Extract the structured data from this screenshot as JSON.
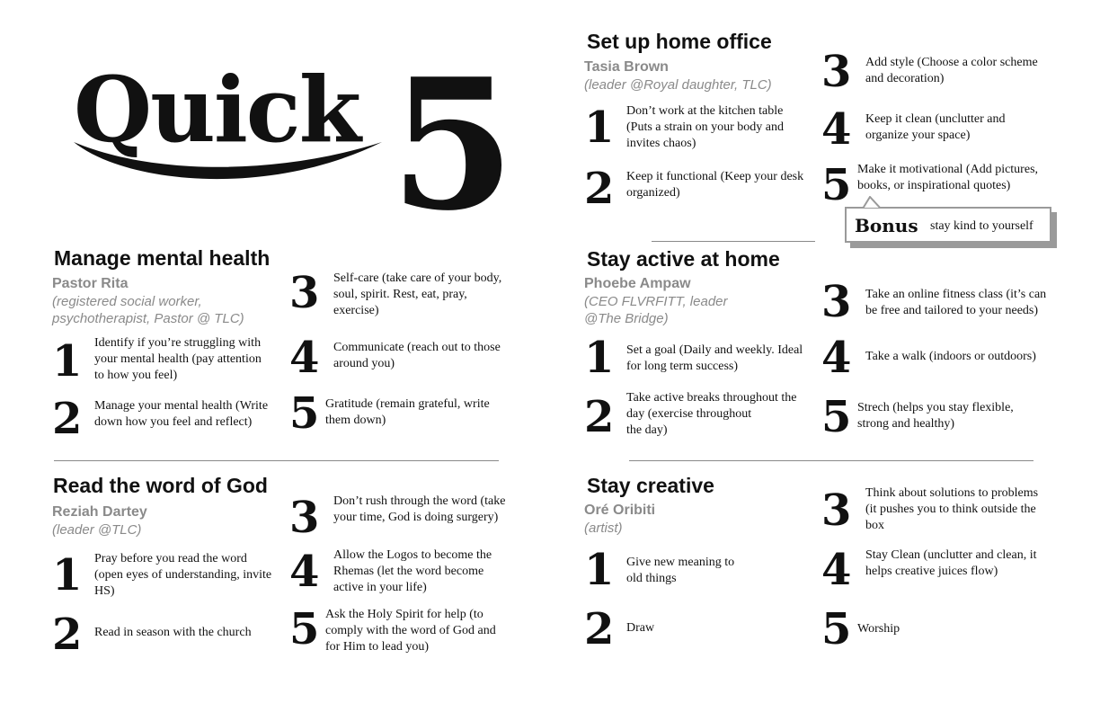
{
  "logo": {
    "word": "Quick",
    "number": "5"
  },
  "sections": {
    "mental": {
      "title": "Manage mental health",
      "author": "Pastor Rita",
      "role": [
        "(registered social worker,",
        "psychotherapist, Pastor @ TLC)"
      ],
      "items": [
        {
          "n": "1",
          "lines": [
            "Identify if you’re struggling with",
            "your mental health (pay attention",
            "to how you feel)"
          ]
        },
        {
          "n": "2",
          "lines": [
            "Manage your mental health (Write",
            "down how you feel and reflect)"
          ]
        },
        {
          "n": "3",
          "lines": [
            "Self-care (take care of your body,",
            "soul, spirit. Rest, eat, pray,",
            "exercise)"
          ]
        },
        {
          "n": "4",
          "lines": [
            "Communicate (reach out to those",
            "around you)"
          ]
        },
        {
          "n": "5",
          "lines": [
            "Gratitude (remain grateful, write",
            "them down)"
          ]
        }
      ]
    },
    "word": {
      "title": "Read the word of God",
      "author": "Reziah Dartey",
      "role": [
        "(leader @TLC)"
      ],
      "items": [
        {
          "n": "1",
          "lines": [
            "Pray before you read the word",
            "(open eyes of understanding, invite",
            "HS)"
          ]
        },
        {
          "n": "2",
          "lines": [
            "Read in season with the church"
          ]
        },
        {
          "n": "3",
          "lines": [
            "Don’t rush through the word (take",
            "your time, God is doing surgery)"
          ]
        },
        {
          "n": "4",
          "lines": [
            "Allow the Logos to become the",
            "Rhemas (let the word become",
            "active in your life)"
          ]
        },
        {
          "n": "5",
          "lines": [
            "Ask the Holy Spirit for help (to",
            "comply with the word of God and",
            "for Him to lead you)"
          ]
        }
      ]
    },
    "office": {
      "title": "Set up home office",
      "author": "Tasia Brown",
      "role": [
        "(leader @Royal daughter, TLC)"
      ],
      "items": [
        {
          "n": "1",
          "lines": [
            "Don’t work at the kitchen table",
            "(Puts a strain on your body and",
            "invites chaos)"
          ]
        },
        {
          "n": "2",
          "lines": [
            "Keep it functional (Keep your desk",
            "organized)"
          ]
        },
        {
          "n": "3",
          "lines": [
            "Add style (Choose a color scheme",
            "and decoration)"
          ]
        },
        {
          "n": "4",
          "lines": [
            "Keep it clean (unclutter and",
            "organize your space)"
          ]
        },
        {
          "n": "5",
          "lines": [
            "Make it motivational (Add pictures,",
            "books, or inspirational quotes)"
          ]
        }
      ],
      "bonus": {
        "label": "Bonus",
        "text": "stay kind to yourself"
      }
    },
    "active": {
      "title": "Stay active at home",
      "author": "Phoebe Ampaw",
      "role": [
        "(CEO FLVRFITT, leader",
        "@The Bridge)"
      ],
      "items": [
        {
          "n": "1",
          "lines": [
            "Set a goal (Daily and weekly. Ideal",
            "for long term success)"
          ]
        },
        {
          "n": "2",
          "lines": [
            "Take active breaks throughout the",
            "day (exercise throughout",
            "the day)"
          ]
        },
        {
          "n": "3",
          "lines": [
            "Take an online fitness class (it’s can",
            "be free and tailored to your needs)"
          ]
        },
        {
          "n": "4",
          "lines": [
            "Take a walk (indoors or outdoors)"
          ]
        },
        {
          "n": "5",
          "lines": [
            "Strech (helps you stay flexible,",
            "strong and healthy)"
          ]
        }
      ]
    },
    "creative": {
      "title": "Stay creative",
      "author": "Oré Oribiti",
      "role": [
        "(artist)"
      ],
      "items": [
        {
          "n": "1",
          "lines": [
            "Give new meaning to",
            "old things"
          ]
        },
        {
          "n": "2",
          "lines": [
            "Draw"
          ]
        },
        {
          "n": "3",
          "lines": [
            "Think about solutions to problems",
            "(it pushes you to think outside the",
            "box"
          ]
        },
        {
          "n": "4",
          "lines": [
            "Stay Clean (unclutter and clean, it",
            "helps creative juices flow)"
          ]
        },
        {
          "n": "5",
          "lines": [
            "Worship"
          ]
        }
      ]
    }
  }
}
